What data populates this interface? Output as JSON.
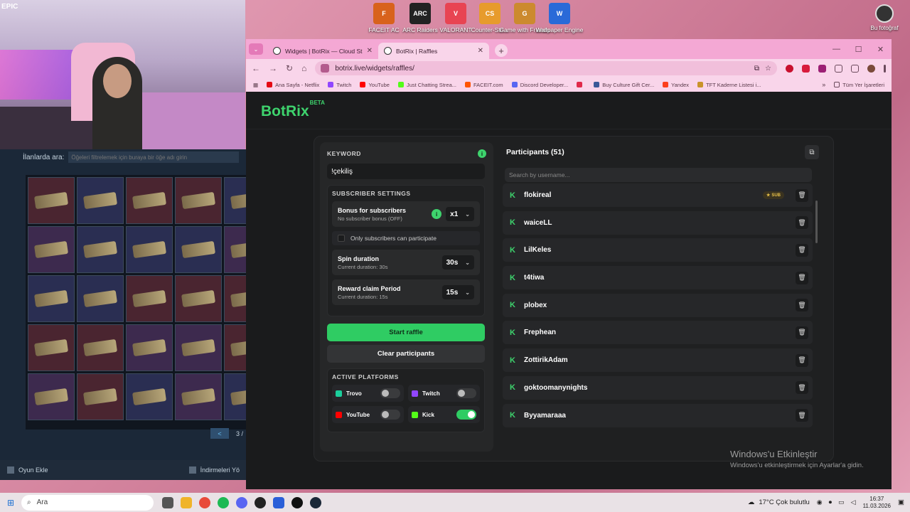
{
  "desktop": {
    "icons": [
      {
        "label": "FACEIT AC",
        "color": "#d8621c",
        "glyph": "F"
      },
      {
        "label": "ARC Raiders",
        "color": "#222222",
        "glyph": "ARC"
      },
      {
        "label": "VALORANT",
        "color": "#e84452",
        "glyph": "V"
      },
      {
        "label": "Counter-Stri...",
        "color": "#e79b2c",
        "glyph": "CS"
      },
      {
        "label": "Game with Friends",
        "color": "#cc8a2e",
        "glyph": "G"
      },
      {
        "label": "Wallpaper Engine",
        "color": "#2a6ad8",
        "glyph": "W"
      }
    ],
    "corner_label": "Bu fotoğraf"
  },
  "webcam": {
    "tag": "EPIC"
  },
  "steam": {
    "search_label": "İlanlarda ara:",
    "search_placeholder": "Öğeleri filtrelemek için buraya bir öğe adı girin",
    "page": "3 /",
    "prev": "<",
    "add_game": "Oyun Ekle",
    "downloads": "İndirmeleri Yö"
  },
  "browser": {
    "tabs": [
      {
        "title": "Widgets | BotRix — Cloud Strea",
        "active": false
      },
      {
        "title": "BotRix | Raffles",
        "active": true
      }
    ],
    "url": "botrix.live/widgets/raffles/",
    "bookmarks": [
      {
        "label": "Ana Sayfa - Netflix",
        "color": "#e50914"
      },
      {
        "label": "Twitch",
        "color": "#9146ff"
      },
      {
        "label": "YouTube",
        "color": "#ff0000"
      },
      {
        "label": "Just Chatting Strea...",
        "color": "#53fc18"
      },
      {
        "label": "FACEIT.com",
        "color": "#ff5500"
      },
      {
        "label": "Discord Developer...",
        "color": "#5865f2"
      },
      {
        "label": "",
        "color": "#e0294a"
      },
      {
        "label": "Buy Culture Gift Cer...",
        "color": "#3b5998"
      },
      {
        "label": "Yandex",
        "color": "#fc3f1d"
      },
      {
        "label": "TFT Kaderne Listesi i...",
        "color": "#c9932a"
      }
    ],
    "bookmarks_more": "»",
    "all_bookmarks": "Tüm Yer İşaretleri"
  },
  "botrix": {
    "brand": "BotRix",
    "brand_tag": "BETA",
    "keyword_label": "KEYWORD",
    "keyword_value": "!çekiliş",
    "subscriber_settings": "SUBSCRIBER SETTINGS",
    "bonus_title": "Bonus for subscribers",
    "bonus_sub": "No subscriber bonus (OFF)",
    "bonus_value": "x1",
    "only_subs": "Only subscribers can participate",
    "spin_title": "Spin duration",
    "spin_sub": "Current duration: 30s",
    "spin_value": "30s",
    "reward_title": "Reward claim Period",
    "reward_sub": "Current duration: 15s",
    "reward_value": "15s",
    "start_raffle": "Start raffle",
    "clear_participants": "Clear participants",
    "active_platforms": "ACTIVE PLATFORMS",
    "platforms": [
      {
        "name": "Trovo",
        "color": "#1bcf9c",
        "on": false
      },
      {
        "name": "Twitch",
        "color": "#9146ff",
        "on": false
      },
      {
        "name": "YouTube",
        "color": "#ff0000",
        "on": false
      },
      {
        "name": "Kick",
        "color": "#53fc18",
        "on": true
      }
    ],
    "participants_title": "Participants (51)",
    "search_placeholder": "Search by username...",
    "participants": [
      {
        "name": "flokireal",
        "sub": true
      },
      {
        "name": "waiceLL",
        "sub": false
      },
      {
        "name": "LilKeles",
        "sub": false
      },
      {
        "name": "t4tiwa",
        "sub": false
      },
      {
        "name": "plobex",
        "sub": false
      },
      {
        "name": "Frephean",
        "sub": false
      },
      {
        "name": "ZottirikAdam",
        "sub": false
      },
      {
        "name": "goktoomanynights",
        "sub": false
      },
      {
        "name": "Byyamaraaa",
        "sub": false
      }
    ],
    "sub_badge": "SUB"
  },
  "activate": {
    "title": "Windows'u Etkinleştir",
    "subtitle": "Windows'u etkinleştirmek için Ayarlar'a gidin."
  },
  "taskbar": {
    "search": "Ara",
    "weather": "17°C  Çok bulutlu",
    "time": "16:37",
    "date": "11.03.2026"
  }
}
